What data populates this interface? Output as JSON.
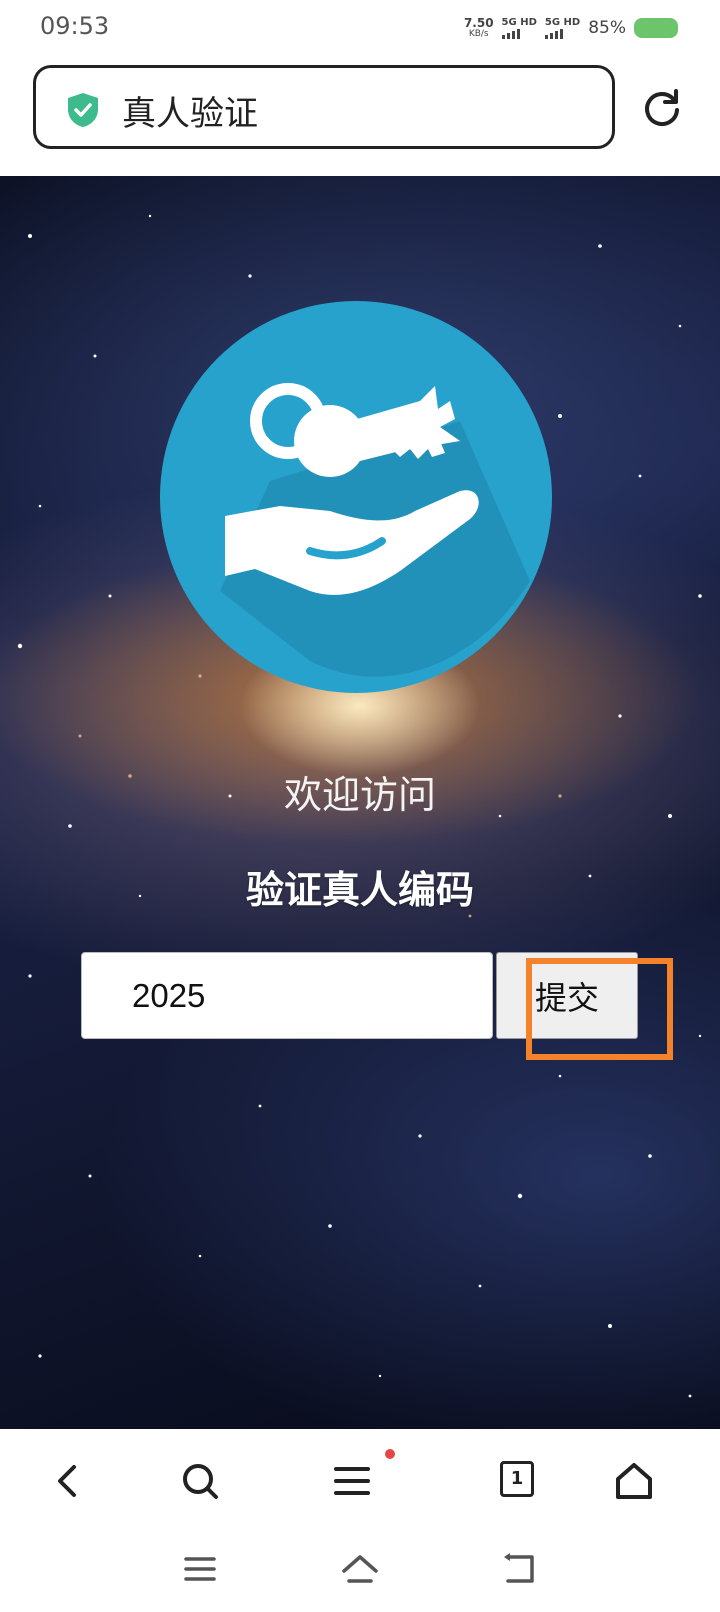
{
  "status_bar": {
    "time": "09:53",
    "net_speed": "7.50",
    "net_speed_unit": "KB/s",
    "sim1": "5G HD",
    "sim2": "5G HD",
    "battery": "85%"
  },
  "address_bar": {
    "title": "真人验证",
    "secure_icon": "shield-check-icon",
    "reload_icon": "reload-icon"
  },
  "page": {
    "welcome": "欢迎访问",
    "code_label": "验证真人编码",
    "code_value": "2025",
    "submit_label": "提交",
    "logo_icon": "key-in-hand-icon",
    "highlight_color": "#f4822a",
    "logo_color": "#27a2cc"
  },
  "toolbar": {
    "icons": [
      "back-icon",
      "search-icon",
      "menu-icon",
      "tabs-icon",
      "home-icon"
    ],
    "tab_count": "1"
  },
  "system_nav": {
    "icons": [
      "recent-apps-icon",
      "home-icon",
      "back-icon"
    ]
  }
}
